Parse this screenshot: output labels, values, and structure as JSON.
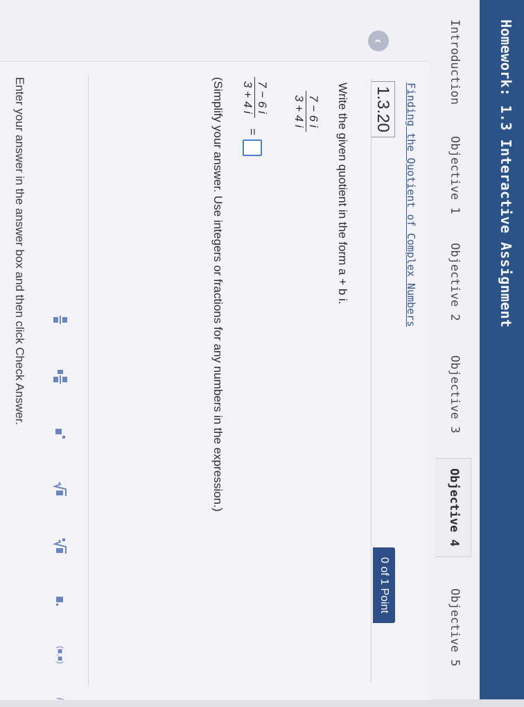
{
  "header": {
    "title": "Homework: 1.3 Interactive Assignment"
  },
  "tabs": [
    {
      "label": "Introduction"
    },
    {
      "label": "Objective 1"
    },
    {
      "label": "Objective 2"
    },
    {
      "label": "Objective 3"
    },
    {
      "label": "Objective 4",
      "active": true
    },
    {
      "label": "Objective 5"
    }
  ],
  "section": {
    "link": "Finding the Quotient of Complex Numbers"
  },
  "question": {
    "number": "1.3.20",
    "points": "0 of 1 Point",
    "instruction": "Write the given quotient in the form a + b i.",
    "fraction": {
      "numerator": "7 − 6 i",
      "denominator": "3 + 4 i"
    },
    "equation": {
      "numerator": "7 − 6 i",
      "denominator": "3 + 4 i",
      "equals": "="
    },
    "hint": "(Simplify your answer. Use integers or fractions for any numbers in the expression.)"
  },
  "toolbar": {
    "fraction_icon": "fraction-icon",
    "mixed_number_icon": "mixed-number-icon",
    "exponent_icon": "exponent-icon",
    "sqrt_icon": "square-root-icon",
    "nth_root_icon": "nth-root-icon",
    "decimal_icon": "decimal-icon",
    "interval_label": "(■,■)",
    "imaginary_label": "i"
  },
  "footer": {
    "text": "Enter your answer in the answer box and then click Check Answer."
  },
  "colors": {
    "header": "#2c5388",
    "badge": "#2d4e86",
    "link": "#3c5a8e",
    "answer_border": "#4a7ed0"
  }
}
